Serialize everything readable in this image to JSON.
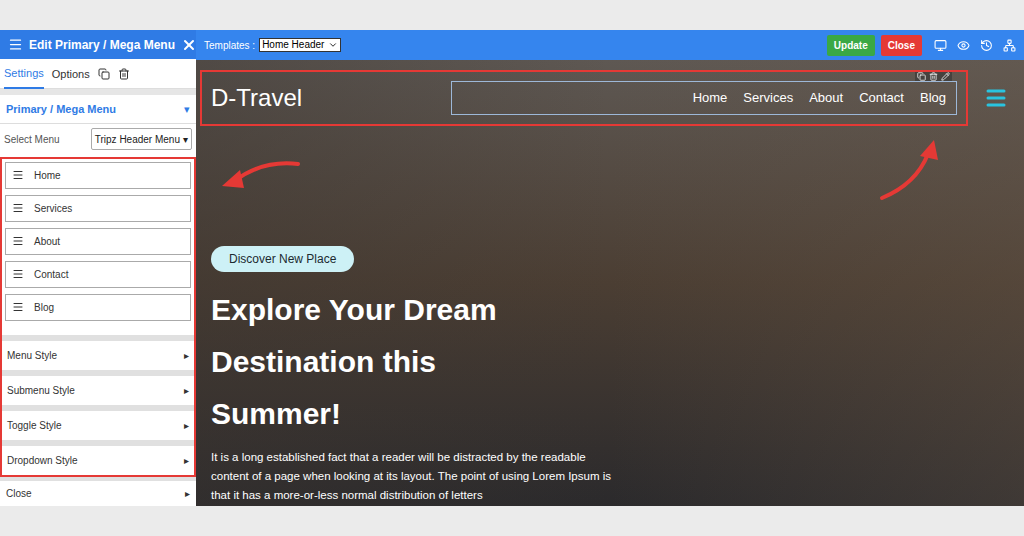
{
  "panel": {
    "title": "Edit Primary / Mega Menu",
    "tabs": [
      {
        "label": "Settings",
        "selected": true
      },
      {
        "label": "Options",
        "selected": false
      }
    ],
    "section": {
      "label": "Primary / Mega Menu",
      "caret": "▾"
    },
    "select_menu": {
      "label": "Select Menu",
      "value": "Tripz Header Menu",
      "caret": "▾"
    },
    "menu_items": [
      "Home",
      "Services",
      "About",
      "Contact",
      "Blog"
    ],
    "style_sections": [
      {
        "label": "Menu Style",
        "caret": "▸"
      },
      {
        "label": "Submenu Style",
        "caret": "▸"
      },
      {
        "label": "Toggle Style",
        "caret": "▸"
      },
      {
        "label": "Dropdown Style",
        "caret": "▸"
      }
    ],
    "close": {
      "label": "Close",
      "caret": "▸"
    }
  },
  "toolbar": {
    "templates_label": "Templates :",
    "template": "Home Header",
    "buttons": [
      {
        "label": "Update",
        "color": "#3aa845"
      },
      {
        "label": "Close",
        "color": "#e53935"
      }
    ]
  },
  "site": {
    "logo": "D-Travel",
    "nav": [
      "Home",
      "Services",
      "About",
      "Contact",
      "Blog"
    ],
    "badge": "Discover New Place",
    "heading": "Explore Your Dream Destination this Summer!",
    "paragraph": "It is a long established fact that a reader will be distracted by the readable content of a page when looking at its layout. The point of using Lorem Ipsum is that it has a more-or-less normal distribution of letters"
  }
}
